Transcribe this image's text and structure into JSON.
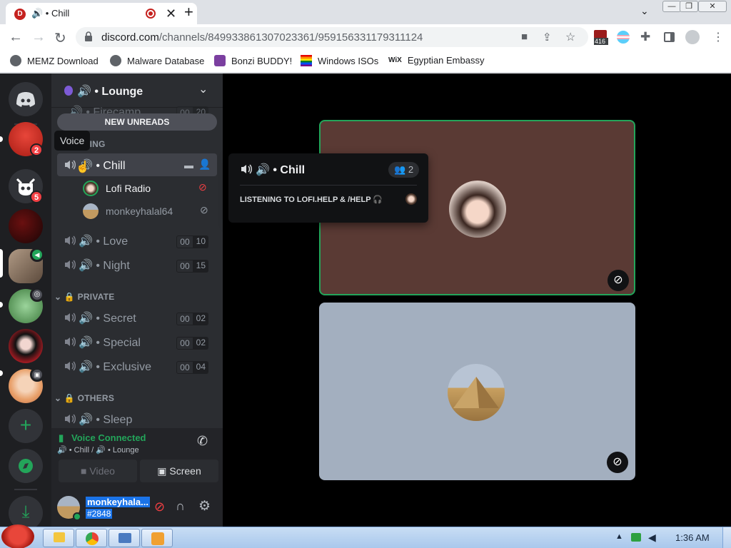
{
  "browser": {
    "tab_title": "🔊 • Chill",
    "url_host": "discord.com",
    "url_path": "/channels/849933861307023361/959156331179311124",
    "ext_badge": "416",
    "bookmarks": [
      {
        "label": "MEMZ Download",
        "icon": "globe-icon"
      },
      {
        "label": "Malware Database",
        "icon": "globe-icon"
      },
      {
        "label": "Bonzi BUDDY!",
        "icon": "bonzi-icon"
      },
      {
        "label": "Windows ISOs",
        "icon": "rainbow-flag-icon"
      },
      {
        "label": "Egyptian Embassy",
        "icon": "wix-icon"
      }
    ]
  },
  "servers": [
    {
      "name": "angry-bird-server",
      "badge": "2",
      "color": "#d9352b"
    },
    {
      "name": "bot-server",
      "badge": "5",
      "color": "#313338"
    },
    {
      "name": "red-dark-server",
      "badge": "",
      "color": "#4a0c0c"
    },
    {
      "name": "lounge-server",
      "badge": "",
      "color": "#8a7a6a"
    },
    {
      "name": "green-server",
      "badge": "",
      "color": "#5aa05a"
    },
    {
      "name": "anime-red-server",
      "badge": "",
      "color": "#b01c24"
    },
    {
      "name": "anime-orange-server",
      "badge": "",
      "color": "#e8a06a"
    }
  ],
  "guild": {
    "name": "🔊 • Lounge",
    "new_unreads": "NEW UNREADS",
    "tooltip": "Voice",
    "partial_channel": "🔊 • Firecamp",
    "partial_limit": [
      "00",
      "20"
    ],
    "partial_category": "TING",
    "active_channel": "🔊 • Chill",
    "members": [
      {
        "name": "Lofi Radio"
      },
      {
        "name": "monkeyhalal64"
      }
    ],
    "channels_a": [
      {
        "name": "🔊 • Love",
        "limit": [
          "00",
          "10"
        ]
      },
      {
        "name": "🔊 • Night",
        "limit": [
          "00",
          "15"
        ]
      }
    ],
    "cat_private": "🔒 PRIVATE",
    "channels_b": [
      {
        "name": "🔊 • Secret",
        "limit": [
          "00",
          "02"
        ]
      },
      {
        "name": "🔊 • Special",
        "limit": [
          "00",
          "02"
        ]
      },
      {
        "name": "🔊 • Exclusive",
        "limit": [
          "00",
          "04"
        ]
      }
    ],
    "cat_others": "🔒 OTHERS",
    "channels_c": [
      {
        "name": "🔊 • Sleep"
      }
    ]
  },
  "voice": {
    "status": "Voice Connected",
    "location": "🔊 • Chill / 🔊 • Lounge",
    "video_label": "Video",
    "screen_label": "Screen"
  },
  "user": {
    "name": "monkeyhala...",
    "tag": "#2848"
  },
  "popup": {
    "title": "🔊 • Chill",
    "count": "2",
    "activity": "LISTENING TO LOFI.HELP & /HELP 🎧"
  },
  "taskbar": {
    "time": "1:36 AM"
  },
  "colors": {
    "accent_green": "#23a55a",
    "tile_top": "#5a3a34",
    "tile_bottom": "#a3afbf"
  }
}
